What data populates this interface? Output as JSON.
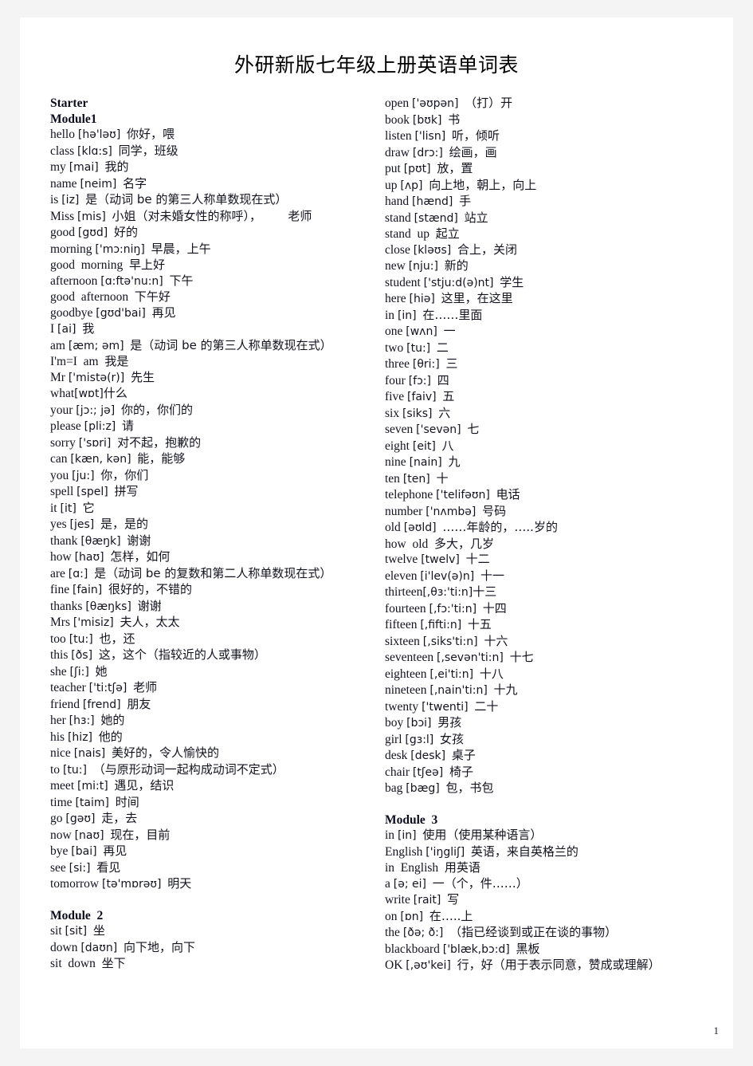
{
  "document": {
    "title": "外研新版七年级上册英语单词表",
    "page_number": "1"
  },
  "left_column": [
    {
      "kind": "module",
      "text": "Starter"
    },
    {
      "kind": "module",
      "text": "Module1"
    },
    {
      "kind": "entry",
      "en": "hello",
      "ph": "[hə'ləʊ]",
      "cn": "你好，喂"
    },
    {
      "kind": "entry",
      "en": "class",
      "ph": "[klɑ:s]",
      "cn": "同学，班级"
    },
    {
      "kind": "entry",
      "en": "my",
      "ph": "[mai]",
      "cn": "我的"
    },
    {
      "kind": "entry",
      "en": "name",
      "ph": "[neim]",
      "cn": "名字"
    },
    {
      "kind": "entry",
      "en": "is",
      "ph": "[iz]",
      "cn": "是（动词 be 的第三人称单数现在式）"
    },
    {
      "kind": "entry",
      "en": "Miss",
      "ph": "[mis]",
      "cn": "小姐（对未婚女性的称呼），       老师"
    },
    {
      "kind": "entry",
      "en": "good",
      "ph": "[gʊd]",
      "cn": "好的"
    },
    {
      "kind": "entry",
      "en": "morning",
      "ph": "['mɔ:niŋ]",
      "cn": "早晨，上午"
    },
    {
      "kind": "entry",
      "en": "good  morning",
      "ph": "",
      "cn": "早上好"
    },
    {
      "kind": "entry",
      "en": "afternoon",
      "ph": "[ɑ:ftə'nu:n]",
      "cn": "下午"
    },
    {
      "kind": "entry",
      "en": "good  afternoon",
      "ph": "",
      "cn": "下午好"
    },
    {
      "kind": "entry",
      "en": "goodbye",
      "ph": "[gʊd'bai]",
      "cn": "再见"
    },
    {
      "kind": "entry",
      "en": "I",
      "ph": "[ai]",
      "cn": "我"
    },
    {
      "kind": "entry",
      "en": "am",
      "ph": "[æm; əm]",
      "cn": "是（动词 be 的第三人称单数现在式）"
    },
    {
      "kind": "entry",
      "en": "I'm=I  am",
      "ph": "",
      "cn": "我是"
    },
    {
      "kind": "entry",
      "en": "Mr",
      "ph": "['mistə(r)]",
      "cn": "先生"
    },
    {
      "kind": "entry",
      "en": "what",
      "ph": "[wɒt]",
      "cn": "什么",
      "tight": true
    },
    {
      "kind": "entry",
      "en": "your",
      "ph": "[jɔ:; jə]",
      "cn": "你的，你们的"
    },
    {
      "kind": "entry",
      "en": "please",
      "ph": "[pli:z]",
      "cn": "请"
    },
    {
      "kind": "entry",
      "en": "sorry",
      "ph": "['sɒri]",
      "cn": "对不起，抱歉的"
    },
    {
      "kind": "entry",
      "en": "can",
      "ph": "[kæn, kən]",
      "cn": "能，能够"
    },
    {
      "kind": "entry",
      "en": "you",
      "ph": "[ju:]",
      "cn": "你，你们"
    },
    {
      "kind": "entry",
      "en": "spell",
      "ph": "[spel]",
      "cn": "拼写"
    },
    {
      "kind": "entry",
      "en": "it",
      "ph": "[it]",
      "cn": "它"
    },
    {
      "kind": "entry",
      "en": "yes",
      "ph": "[jes]",
      "cn": "是，是的"
    },
    {
      "kind": "entry",
      "en": "thank",
      "ph": "[θæŋk]",
      "cn": "谢谢"
    },
    {
      "kind": "entry",
      "en": "how",
      "ph": "[haʊ]",
      "cn": "怎样，如何"
    },
    {
      "kind": "entry",
      "en": "are",
      "ph": "[ɑ:]",
      "cn": "是（动词 be 的复数和第二人称单数现在式）"
    },
    {
      "kind": "entry",
      "en": "fine",
      "ph": "[fain]",
      "cn": "很好的，不错的"
    },
    {
      "kind": "entry",
      "en": "thanks",
      "ph": "[θæŋks]",
      "cn": "谢谢"
    },
    {
      "kind": "entry",
      "en": "Mrs",
      "ph": "['misiz]",
      "cn": "夫人，太太"
    },
    {
      "kind": "entry",
      "en": "too",
      "ph": "[tu:]",
      "cn": "也，还"
    },
    {
      "kind": "entry",
      "en": "this",
      "ph": "[ðs]",
      "cn": "这，这个（指较近的人或事物）"
    },
    {
      "kind": "entry",
      "en": "she",
      "ph": "[ʃi:]",
      "cn": "她"
    },
    {
      "kind": "entry",
      "en": "teacher",
      "ph": "['ti:tʃə]",
      "cn": "老师"
    },
    {
      "kind": "entry",
      "en": "friend",
      "ph": "[frend]",
      "cn": "朋友"
    },
    {
      "kind": "entry",
      "en": "her",
      "ph": "[hɜ:]",
      "cn": "她的"
    },
    {
      "kind": "entry",
      "en": "his",
      "ph": "[hiz]",
      "cn": "他的"
    },
    {
      "kind": "entry",
      "en": "nice",
      "ph": "[nais]",
      "cn": "美好的，令人愉快的"
    },
    {
      "kind": "entry",
      "en": "to",
      "ph": "[tu:]",
      "cn": "（与原形动词一起构成动词不定式）"
    },
    {
      "kind": "entry",
      "en": "meet",
      "ph": "[mi:t]",
      "cn": "遇见，结识"
    },
    {
      "kind": "entry",
      "en": "time",
      "ph": "[taim]",
      "cn": "时间"
    },
    {
      "kind": "entry",
      "en": "go",
      "ph": "[gəʊ]",
      "cn": "走，去"
    },
    {
      "kind": "entry",
      "en": "now",
      "ph": "[naʊ]",
      "cn": "现在，目前"
    },
    {
      "kind": "entry",
      "en": "bye",
      "ph": "[bai]",
      "cn": "再见"
    },
    {
      "kind": "entry",
      "en": "see",
      "ph": "[si:]",
      "cn": "看见"
    },
    {
      "kind": "entry",
      "en": "tomorrow",
      "ph": "[tə'mɒrəʊ]",
      "cn": "明天"
    },
    {
      "kind": "module",
      "text": "Module  2",
      "spaced": true
    },
    {
      "kind": "entry",
      "en": "sit",
      "ph": "[sit]",
      "cn": "坐"
    },
    {
      "kind": "entry",
      "en": "down",
      "ph": "[daʊn]",
      "cn": "向下地，向下"
    },
    {
      "kind": "entry",
      "en": "sit  down",
      "ph": "",
      "cn": "坐下"
    }
  ],
  "right_column": [
    {
      "kind": "entry",
      "en": "open",
      "ph": "['əʊpən]",
      "cn": "（打）开"
    },
    {
      "kind": "entry",
      "en": "book",
      "ph": "[bʊk]",
      "cn": "书"
    },
    {
      "kind": "entry",
      "en": "listen",
      "ph": "['lisn]",
      "cn": "听，倾听"
    },
    {
      "kind": "entry",
      "en": "draw",
      "ph": "[drɔ:]",
      "cn": "绘画，画"
    },
    {
      "kind": "entry",
      "en": "put",
      "ph": "[pʊt]",
      "cn": "放，置"
    },
    {
      "kind": "entry",
      "en": "up",
      "ph": "[ʌp]",
      "cn": "向上地，朝上，向上"
    },
    {
      "kind": "entry",
      "en": "hand",
      "ph": "[hænd]",
      "cn": "手"
    },
    {
      "kind": "entry",
      "en": "stand",
      "ph": "[stænd]",
      "cn": "站立"
    },
    {
      "kind": "entry",
      "en": "stand  up",
      "ph": "",
      "cn": "起立"
    },
    {
      "kind": "entry",
      "en": "close",
      "ph": "[kləʊs]",
      "cn": "合上，关闭"
    },
    {
      "kind": "entry",
      "en": "new",
      "ph": "[nju:]",
      "cn": "新的"
    },
    {
      "kind": "entry",
      "en": "student",
      "ph": "['stju:d(ə)nt]",
      "cn": "学生"
    },
    {
      "kind": "entry",
      "en": "here",
      "ph": "[hiə]",
      "cn": "这里，在这里"
    },
    {
      "kind": "entry",
      "en": "in",
      "ph": "[in]",
      "cn": "在……里面"
    },
    {
      "kind": "entry",
      "en": "one",
      "ph": "[wʌn]",
      "cn": "一"
    },
    {
      "kind": "entry",
      "en": "two",
      "ph": "[tu:]",
      "cn": "二"
    },
    {
      "kind": "entry",
      "en": "three",
      "ph": "[θri:]",
      "cn": "三"
    },
    {
      "kind": "entry",
      "en": "four",
      "ph": "[fɔ:]",
      "cn": "四"
    },
    {
      "kind": "entry",
      "en": "five",
      "ph": "[faiv]",
      "cn": "五"
    },
    {
      "kind": "entry",
      "en": "six",
      "ph": "[siks]",
      "cn": "六"
    },
    {
      "kind": "entry",
      "en": "seven",
      "ph": "['sevən]",
      "cn": "七"
    },
    {
      "kind": "entry",
      "en": "eight",
      "ph": "[eit]",
      "cn": "八"
    },
    {
      "kind": "entry",
      "en": "nine",
      "ph": "[nain]",
      "cn": "九"
    },
    {
      "kind": "entry",
      "en": "ten",
      "ph": "[ten]",
      "cn": "十"
    },
    {
      "kind": "entry",
      "en": "telephone",
      "ph": "['telifəʊn]",
      "cn": "电话"
    },
    {
      "kind": "entry",
      "en": "number",
      "ph": "['nʌmbə]",
      "cn": "号码"
    },
    {
      "kind": "entry",
      "en": "old",
      "ph": "[əʊld]",
      "cn": "……年龄的，…..岁的"
    },
    {
      "kind": "entry",
      "en": "how  old",
      "ph": "",
      "cn": "多大，几岁"
    },
    {
      "kind": "entry",
      "en": "twelve",
      "ph": "[twelv]",
      "cn": "十二"
    },
    {
      "kind": "entry",
      "en": "eleven",
      "ph": "[i'lev(ə)n]",
      "cn": "十一"
    },
    {
      "kind": "entry",
      "en": "thirteen",
      "ph": "[,θɜ:'ti:n]",
      "cn": "十三",
      "tight": true
    },
    {
      "kind": "entry",
      "en": "fourteen",
      "ph": "[,fɔ:'ti:n]",
      "cn": "十四"
    },
    {
      "kind": "entry",
      "en": "fifteen",
      "ph": "[,fifti:n]",
      "cn": "十五"
    },
    {
      "kind": "entry",
      "en": "sixteen",
      "ph": "[,siks'ti:n]",
      "cn": "十六"
    },
    {
      "kind": "entry",
      "en": "seventeen",
      "ph": "[,sevən'ti:n]",
      "cn": "十七"
    },
    {
      "kind": "entry",
      "en": "eighteen",
      "ph": "[,ei'ti:n]",
      "cn": "十八"
    },
    {
      "kind": "entry",
      "en": "nineteen",
      "ph": "[,nain'ti:n]",
      "cn": "十九"
    },
    {
      "kind": "entry",
      "en": "twenty",
      "ph": "['twenti]",
      "cn": "二十"
    },
    {
      "kind": "entry",
      "en": "boy",
      "ph": "[bɔi]",
      "cn": "男孩"
    },
    {
      "kind": "entry",
      "en": "girl",
      "ph": "[gɜ:l]",
      "cn": "女孩"
    },
    {
      "kind": "entry",
      "en": "desk",
      "ph": "[desk]",
      "cn": "桌子"
    },
    {
      "kind": "entry",
      "en": "chair",
      "ph": "[tʃeə]",
      "cn": "椅子"
    },
    {
      "kind": "entry",
      "en": "bag",
      "ph": "[bæg]",
      "cn": "包，书包"
    },
    {
      "kind": "module",
      "text": "Module  3",
      "spaced": true
    },
    {
      "kind": "entry",
      "en": "in",
      "ph": "[in]",
      "cn": "使用（使用某种语言）"
    },
    {
      "kind": "entry",
      "en": "English",
      "ph": "['iŋgliʃ]",
      "cn": "英语，来自英格兰的"
    },
    {
      "kind": "entry",
      "en": "in  English",
      "ph": "",
      "cn": "用英语"
    },
    {
      "kind": "entry",
      "en": "a",
      "ph": "[ə; ei]",
      "cn": "一（个，件……）"
    },
    {
      "kind": "entry",
      "en": "write",
      "ph": "[rait]",
      "cn": "写"
    },
    {
      "kind": "entry",
      "en": "on",
      "ph": "[ɒn]",
      "cn": "在…..上"
    },
    {
      "kind": "entry",
      "en": "the",
      "ph": "[ðə; ð:]",
      "cn": "（指已经谈到或正在谈的事物）"
    },
    {
      "kind": "entry",
      "en": "blackboard",
      "ph": "['blæk,bɔ:d]",
      "cn": "黑板"
    },
    {
      "kind": "entry",
      "en": "OK",
      "ph": "[,əʊ'kei]",
      "cn": "行，好（用于表示同意，赞成或理解）"
    }
  ]
}
